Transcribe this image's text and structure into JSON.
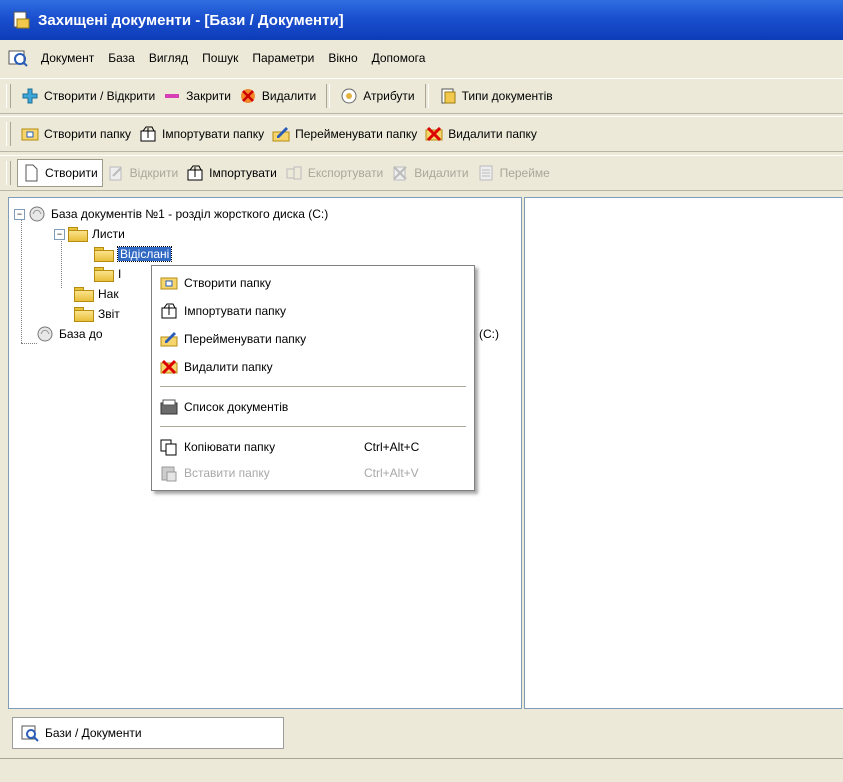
{
  "window": {
    "title": "Захищені документи - [Бази / Документи]"
  },
  "menubar": {
    "items": [
      "Документ",
      "База",
      "Вигляд",
      "Пошук",
      "Параметри",
      "Вікно",
      "Допомога"
    ]
  },
  "toolbar1": {
    "create_open": "Створити / Відкрити",
    "close": "Закрити",
    "delete": "Видалити",
    "attributes": "Атрибути",
    "doc_types": "Типи документів"
  },
  "toolbar2": {
    "create_folder": "Створити папку",
    "import_folder": "Імпортувати папку",
    "rename_folder": "Перейменувати папку",
    "delete_folder": "Видалити папку"
  },
  "toolbar3": {
    "create": "Створити",
    "open": "Відкрити",
    "import": "Імпортувати",
    "export": "Експортувати",
    "delete": "Видалити",
    "rename": "Перейме"
  },
  "tree": {
    "db1": "База документів №1 - розділ жорсткого диска (C:)",
    "letters": "Листи",
    "sent": "Відіслані",
    "received_partial": "I",
    "orders_partial": "Нак",
    "reports_partial": "Звіт",
    "db2_partial": "База до",
    "db2_suffix": "(C:)"
  },
  "context_menu": {
    "create_folder": "Створити папку",
    "import_folder": "Імпортувати папку",
    "rename_folder": "Перейменувати папку",
    "delete_folder": "Видалити папку",
    "doc_list": "Список документів",
    "copy_folder": "Копіювати папку",
    "copy_shortcut": "Ctrl+Alt+C",
    "paste_folder": "Вставити папку",
    "paste_shortcut": "Ctrl+Alt+V"
  },
  "bottom_tab": {
    "label": "Бази / Документи"
  }
}
